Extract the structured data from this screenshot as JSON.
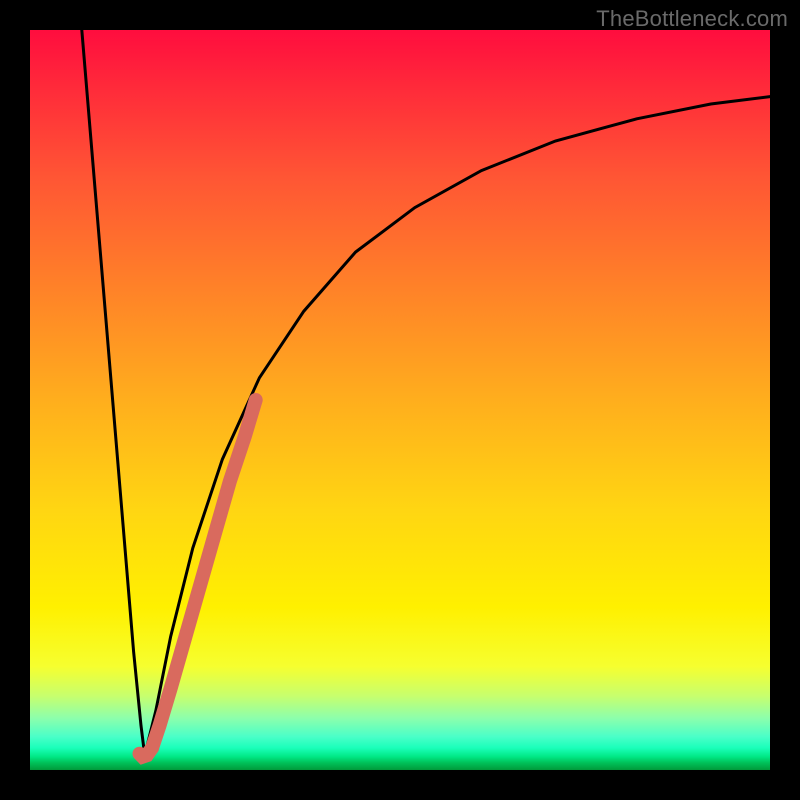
{
  "watermark": "TheBottleneck.com",
  "colors": {
    "curve_main": "#000000",
    "highlight": "#d96a5e"
  },
  "chart_data": {
    "type": "line",
    "title": "",
    "xlabel": "",
    "ylabel": "",
    "xlim": [
      0,
      100
    ],
    "ylim": [
      0,
      100
    ],
    "grid": false,
    "legend": false,
    "series": [
      {
        "name": "left-branch",
        "x": [
          7,
          8,
          9,
          10,
          11,
          12,
          13,
          14,
          15,
          15.5
        ],
        "y": [
          100,
          88,
          76,
          64,
          52,
          40,
          28,
          16,
          6,
          2
        ],
        "color": "#000000"
      },
      {
        "name": "right-branch",
        "x": [
          15.5,
          17,
          19,
          22,
          26,
          31,
          37,
          44,
          52,
          61,
          71,
          82,
          92,
          100
        ],
        "y": [
          2,
          8,
          18,
          30,
          42,
          53,
          62,
          70,
          76,
          81,
          85,
          88,
          90,
          91
        ],
        "color": "#000000"
      },
      {
        "name": "highlight-segment",
        "x": [
          16.5,
          17.5,
          19,
          21,
          23,
          25,
          27,
          29,
          30.5
        ],
        "y": [
          3,
          6,
          11,
          18,
          25,
          32,
          39,
          45,
          50
        ],
        "color": "#d96a5e"
      },
      {
        "name": "highlight-foot",
        "x": [
          14.8,
          15.2,
          15.8,
          16.5
        ],
        "y": [
          2.2,
          1.8,
          2.0,
          3.0
        ],
        "color": "#d96a5e"
      }
    ]
  }
}
